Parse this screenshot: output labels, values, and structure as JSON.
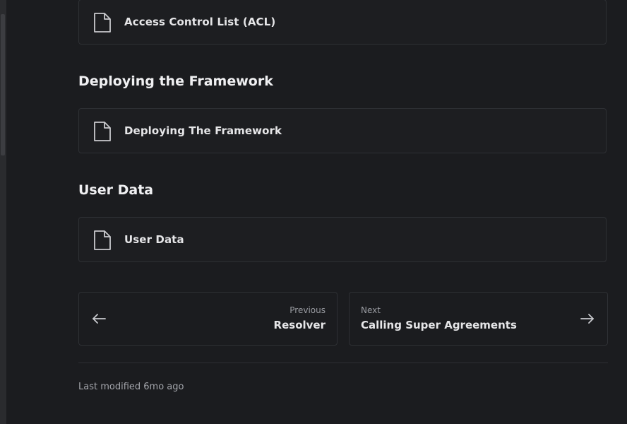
{
  "sections": [
    {
      "title": "",
      "items": [
        {
          "label": "Access Control List (ACL)",
          "icon": "document-icon"
        }
      ]
    },
    {
      "title": "Deploying the Framework",
      "items": [
        {
          "label": "Deploying The Framework",
          "icon": "document-icon"
        }
      ]
    },
    {
      "title": "User Data",
      "items": [
        {
          "label": "User Data",
          "icon": "document-icon"
        }
      ]
    }
  ],
  "pagination": {
    "previous": {
      "caption": "Previous",
      "title": "Resolver",
      "icon": "arrow-left-icon"
    },
    "next": {
      "caption": "Next",
      "title": "Calling Super Agreements",
      "icon": "arrow-right-icon"
    }
  },
  "footer": {
    "last_modified": "Last modified 6mo ago"
  },
  "colors": {
    "background": "#1b1c1f",
    "border": "#2e3034",
    "text": "#e6e6e8",
    "muted": "#9a9ca2"
  }
}
